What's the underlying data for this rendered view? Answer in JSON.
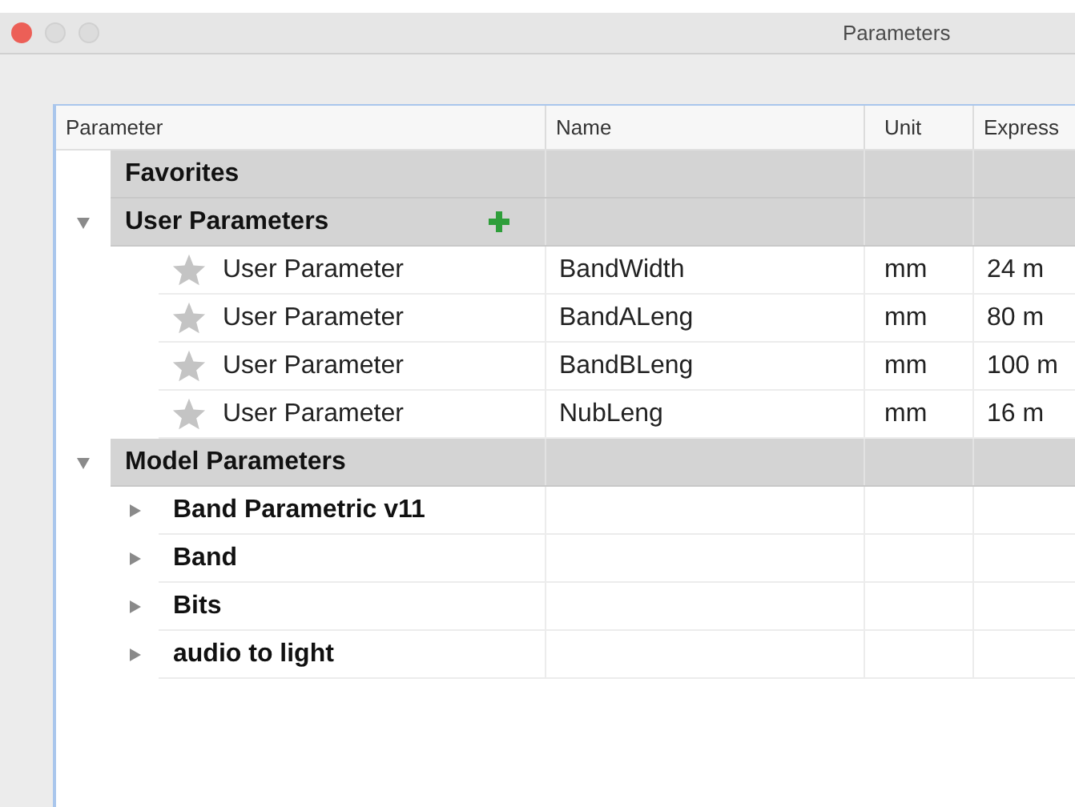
{
  "window": {
    "title": "Parameters"
  },
  "table": {
    "columns": [
      "Parameter",
      "Name",
      "Unit",
      "Express"
    ],
    "groups": [
      {
        "label": "Favorites"
      },
      {
        "label": "User Parameters",
        "expanded": true,
        "add_button": true,
        "children": [
          {
            "kind": "parameter",
            "favorite": false,
            "label": "User Parameter",
            "name": "BandWidth",
            "unit": "mm",
            "expression": "24 m"
          },
          {
            "kind": "parameter",
            "favorite": false,
            "label": "User Parameter",
            "name": "BandALeng",
            "unit": "mm",
            "expression": "80 m"
          },
          {
            "kind": "parameter",
            "favorite": false,
            "label": "User Parameter",
            "name": "BandBLeng",
            "unit": "mm",
            "expression": "100 m"
          },
          {
            "kind": "parameter",
            "favorite": false,
            "label": "User Parameter",
            "name": "NubLeng",
            "unit": "mm",
            "expression": "16 m"
          }
        ]
      },
      {
        "label": "Model Parameters",
        "expanded": true,
        "children": [
          {
            "kind": "group",
            "label": "Band Parametric v11",
            "expanded": false
          },
          {
            "kind": "group",
            "label": "Band",
            "expanded": false
          },
          {
            "kind": "group",
            "label": "Bits",
            "expanded": false
          },
          {
            "kind": "group",
            "label": "audio to light",
            "expanded": false
          }
        ]
      }
    ]
  }
}
